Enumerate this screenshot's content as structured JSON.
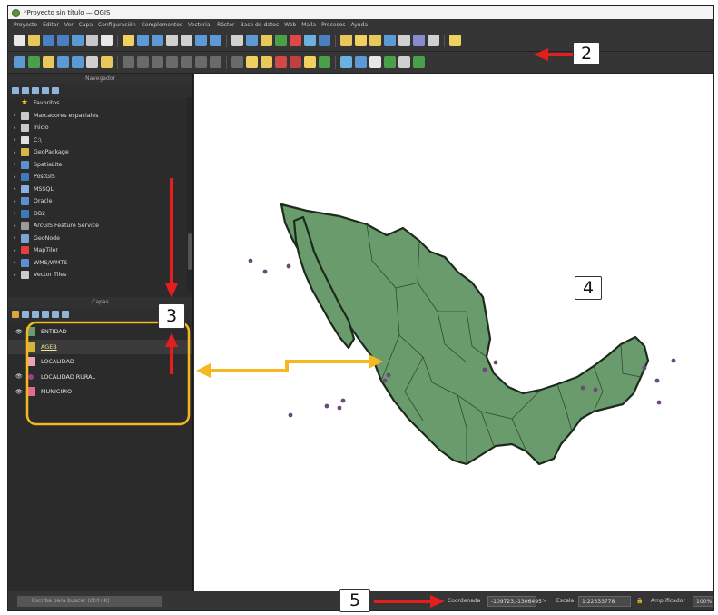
{
  "window": {
    "title": "*Proyecto sin título — QGIS"
  },
  "menu": [
    "Proyecto",
    "Editar",
    "Ver",
    "Capa",
    "Configuración",
    "Complementos",
    "Vectorial",
    "Ráster",
    "Base de datos",
    "Web",
    "Malla",
    "Procesos",
    "Ayuda"
  ],
  "browser": {
    "title": "Navegador",
    "items": [
      {
        "label": "Favoritos",
        "icon": "star-icon",
        "color": "#f2c40f"
      },
      {
        "label": "Marcadores espaciales",
        "icon": "bookmark-icon",
        "color": "#c9c9c9"
      },
      {
        "label": "Inicio",
        "icon": "home-folder-icon",
        "color": "#c9c9c9"
      },
      {
        "label": "C:\\",
        "icon": "drive-icon",
        "color": "#e0e0e0"
      },
      {
        "label": "GeoPackage",
        "icon": "geopackage-icon",
        "color": "#d9b84a"
      },
      {
        "label": "SpatiaLite",
        "icon": "spatialite-icon",
        "color": "#5b8fd1"
      },
      {
        "label": "PostGIS",
        "icon": "postgis-icon",
        "color": "#3e79b8"
      },
      {
        "label": "MSSQL",
        "icon": "mssql-icon",
        "color": "#8ab0e0"
      },
      {
        "label": "Oracle",
        "icon": "oracle-icon",
        "color": "#5b8fd1"
      },
      {
        "label": "DB2",
        "icon": "db2-icon",
        "color": "#3e79b8"
      },
      {
        "label": "ArcGIS Feature Service",
        "icon": "arcgis-icon",
        "color": "#9a9a9a"
      },
      {
        "label": "GeoNode",
        "icon": "geonode-icon",
        "color": "#7aa5d6"
      },
      {
        "label": "MapTiler",
        "icon": "maptiler-icon",
        "color": "#e04040"
      },
      {
        "label": "WMS/WMTS",
        "icon": "globe-icon",
        "color": "#5b8fd1"
      },
      {
        "label": "Vector Tiles",
        "icon": "vector-tiles-icon",
        "color": "#cccccc"
      }
    ]
  },
  "layers": {
    "title": "Capas",
    "items": [
      {
        "label": "ENTIDAD",
        "visible": true,
        "color": "#6a9b6c"
      },
      {
        "label": "AGEB",
        "visible": false,
        "color": "#d4b43c",
        "selected": true
      },
      {
        "label": "LOCALIDAD",
        "visible": false,
        "color": "#e8a5b8"
      },
      {
        "label": "LOCALIDAD RURAL",
        "visible": true,
        "color": "#9c3d8f",
        "point": true
      },
      {
        "label": "MUNICIPIO",
        "visible": true,
        "color": "#e06b8a"
      }
    ]
  },
  "statusbar": {
    "search_placeholder": "Escriba para buscar (Ctrl+K)",
    "coord_label": "Coordenada",
    "coord_value": "-109723,-1306495",
    "scale_label": "Escala",
    "scale_value": "1:22333778",
    "magnifier_label": "Amplificador",
    "magnifier_value": "100%"
  },
  "callouts": [
    "2",
    "3",
    "4",
    "5"
  ],
  "colors": {
    "map_fill": "#6a9b6c",
    "map_border": "#1c2a1c",
    "point": "#6b4a7a",
    "arrow_red": "#e51d1d",
    "arrow_yellow": "#f5b820",
    "box_yellow": "#f5b820"
  }
}
